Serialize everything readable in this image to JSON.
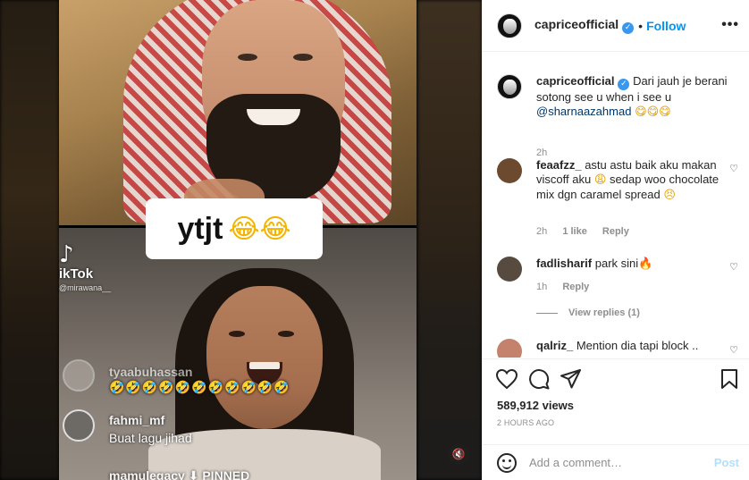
{
  "media": {
    "caption_text": "ytjt",
    "caption_emoji": "😂😂",
    "tiktok_logo": "♪",
    "tiktok_label": "ikTok",
    "tiktok_handle": "@mirawana__",
    "live_comments": [
      {
        "name": "tyaabuhassan",
        "message": "🤣🤣🤣🤣🤣🤣🤣🤣🤣🤣🤣"
      },
      {
        "name": "fahmi_mf",
        "message": "Buat lagu jihad"
      },
      {
        "name": "mamulegacy",
        "message": "⬇ PINNED"
      }
    ],
    "mute_icon": "speaker-muted-icon",
    "mute_glyph": "🔇"
  },
  "header": {
    "username": "capriceofficial",
    "verified_glyph": "✓",
    "separator": "•",
    "follow_label": "Follow",
    "more_glyph": "•••"
  },
  "caption": {
    "username": "capriceofficial",
    "text": "Dari jauh je berani sotong see u when i see u",
    "mention": "@sharnaazahmad",
    "emoji": "😋😋😋",
    "time": "2h"
  },
  "comments": [
    {
      "username": "feaafzz_",
      "text": "astu astu baik aku makan viscoff aku",
      "emoji1": "😩",
      "text2": "sedap woo chocolate mix dgn caramel spread",
      "emoji2": "😣",
      "time": "2h",
      "likes": "1 like",
      "reply": "Reply"
    },
    {
      "username": "fadlisharif",
      "text": "park sini",
      "emoji1": "🔥",
      "time": "1h",
      "reply": "Reply"
    },
    {
      "username": "qalriz_",
      "text": "Mention dia tapi block .."
    }
  ],
  "view_replies": "View replies (1)",
  "heart_glyph": "♡",
  "stats": {
    "views": "589,912 views",
    "time_ago": "2 HOURS AGO"
  },
  "add_comment": {
    "placeholder": "Add a comment…",
    "post_label": "Post"
  },
  "colors": {
    "accent": "#0095f6",
    "post_disabled": "#b2dffc",
    "secondary_text": "#8e8e8e"
  }
}
